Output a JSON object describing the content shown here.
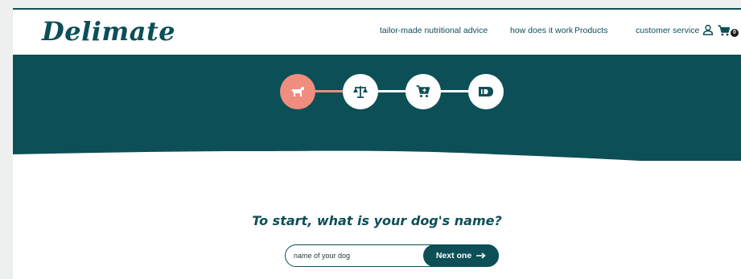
{
  "brand": {
    "logo_text": "Delimate",
    "primary_color": "#0c4f57",
    "accent_color": "#ef8d7f"
  },
  "nav": {
    "items": [
      {
        "label": "tailor-made nutritional advice"
      },
      {
        "label": "how does it work"
      },
      {
        "label": "Products"
      },
      {
        "label": "customer service"
      }
    ],
    "cart_count": "0",
    "icons": [
      "user-icon",
      "cart-icon"
    ]
  },
  "steps": [
    {
      "icon": "dog-icon",
      "state": "active"
    },
    {
      "icon": "scale-icon",
      "state": "upcoming"
    },
    {
      "icon": "cart-plus-icon",
      "state": "upcoming"
    },
    {
      "icon": "tag-id-icon",
      "state": "upcoming"
    }
  ],
  "main": {
    "question": "To start, what is your dog's name?",
    "input_placeholder": "name of your dog",
    "input_value": "",
    "next_button_label": "Next one",
    "next_button_icon": "arrow-right-icon"
  }
}
